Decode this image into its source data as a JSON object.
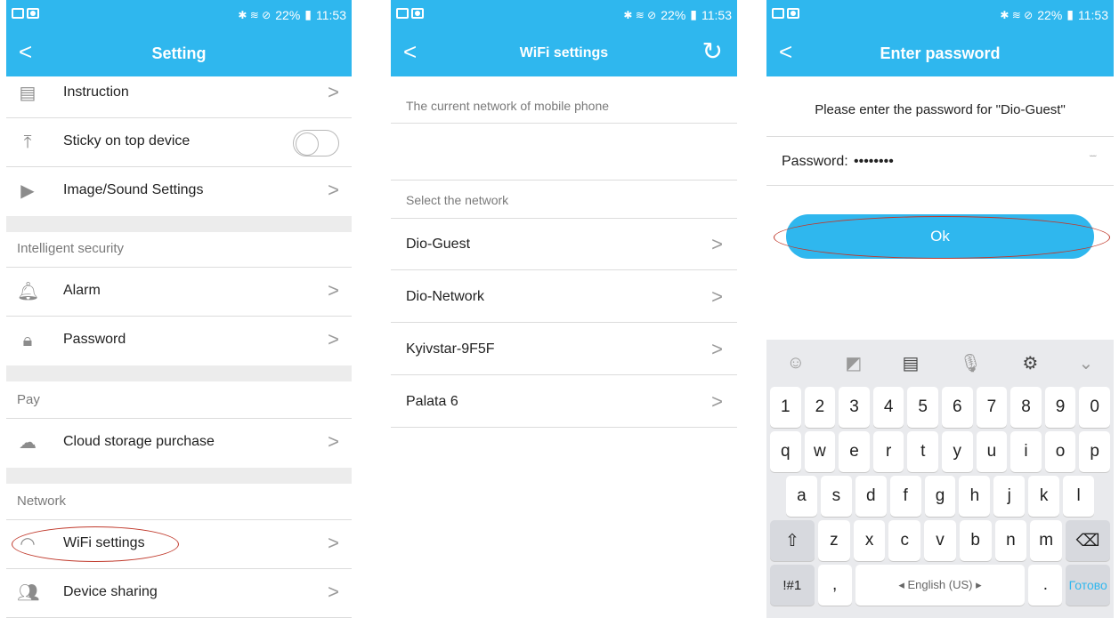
{
  "status": {
    "battery": "22%",
    "time": "11:53"
  },
  "setting": {
    "title": "Setting",
    "rows": [
      {
        "label": "Instruction"
      },
      {
        "label": "Sticky on top device"
      },
      {
        "label": "Image/Sound Settings"
      },
      {
        "label": "Alarm"
      },
      {
        "label": "Password"
      },
      {
        "label": "Cloud storage purchase"
      },
      {
        "label": "WiFi settings"
      },
      {
        "label": "Device sharing"
      }
    ],
    "sections": [
      "Intelligent security",
      "Pay",
      "Network"
    ]
  },
  "wifi": {
    "title": "WiFi settings",
    "current_hint": "The current network of mobile phone",
    "select_hint": "Select the network",
    "networks": [
      "Dio-Guest",
      "Dio-Network",
      "Kyivstar-9F5F",
      "Palata 6"
    ]
  },
  "password": {
    "title": "Enter password",
    "prompt": "Please enter the password for \"Dio-Guest\"",
    "label": "Password:",
    "value": "••••••••",
    "ok": "Ok"
  },
  "keyboard": {
    "digits": [
      "1",
      "2",
      "3",
      "4",
      "5",
      "6",
      "7",
      "8",
      "9",
      "0"
    ],
    "row1": [
      "q",
      "w",
      "e",
      "r",
      "t",
      "y",
      "u",
      "i",
      "o",
      "p"
    ],
    "row2": [
      "a",
      "s",
      "d",
      "f",
      "g",
      "h",
      "j",
      "k",
      "l"
    ],
    "row3": [
      "z",
      "x",
      "c",
      "v",
      "b",
      "n",
      "m"
    ],
    "sym": "!#1",
    "comma": ",",
    "space": "◂ English (US) ▸",
    "period": ".",
    "done": "Готово"
  }
}
